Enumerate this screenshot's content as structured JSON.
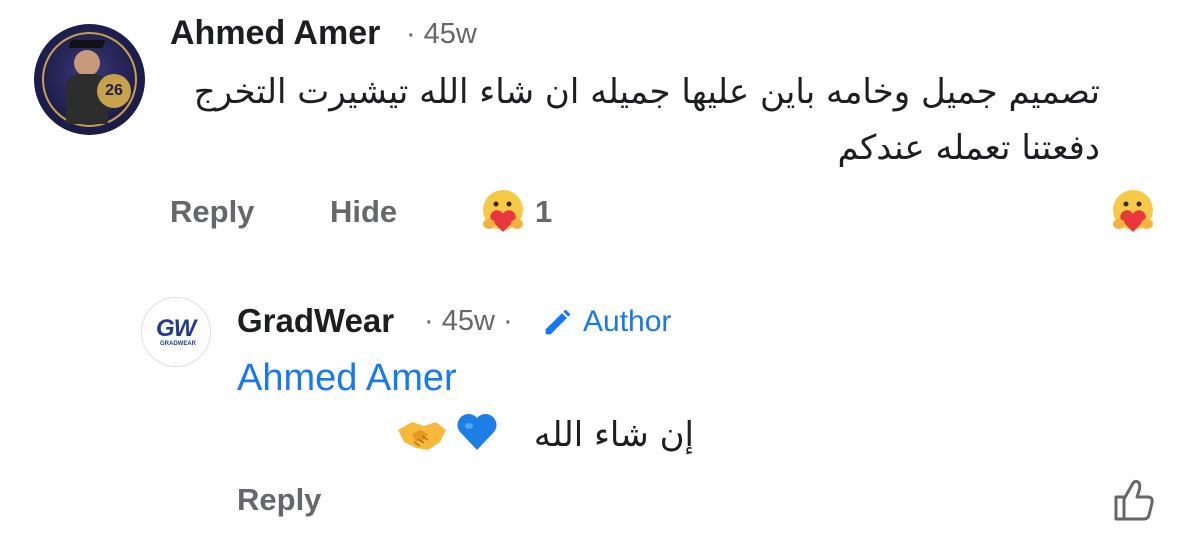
{
  "comment": {
    "author": "Ahmed Amer",
    "time": "45w",
    "text": "تصميم جميل وخامه باين عليها جميله ان شاء الله تيشيرت التخرج دفعتنا تعمله عندكم",
    "actions": {
      "reply_label": "Reply",
      "hide_label": "Hide"
    },
    "reaction_count": "1",
    "reaction_icon": "care-reaction-icon",
    "avatar_badge": "26"
  },
  "reply": {
    "author": "GradWear",
    "time": "45w",
    "author_badge": "Author",
    "mention": "Ahmed Amer",
    "text": "إن شاء الله",
    "emojis": [
      "blue-heart-icon",
      "handshake-icon"
    ],
    "reply_label": "Reply",
    "avatar_logo": "GW",
    "avatar_sub": "GRADWEAR"
  },
  "colors": {
    "text_primary": "#1c1e21",
    "text_secondary": "#65676b",
    "link_blue": "#1877f2"
  }
}
